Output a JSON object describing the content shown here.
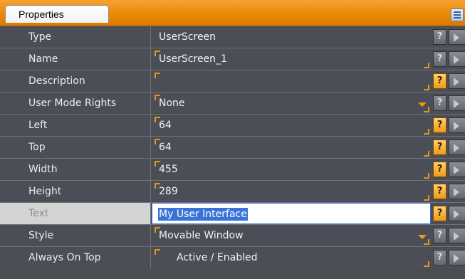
{
  "panel": {
    "tab_label": "Properties",
    "corner_icon": "list-view-icon"
  },
  "properties": [
    {
      "label": "Type",
      "value": "UserScreen",
      "kind": "readonly",
      "help_active": false
    },
    {
      "label": "Name",
      "value": "UserScreen_1",
      "kind": "text",
      "help_active": false
    },
    {
      "label": "Description",
      "value": "",
      "kind": "text",
      "help_active": true
    },
    {
      "label": "User Mode Rights",
      "value": "None",
      "kind": "dropdown",
      "help_active": false
    },
    {
      "label": "Left",
      "value": "64",
      "kind": "text",
      "help_active": true
    },
    {
      "label": "Top",
      "value": "64",
      "kind": "text",
      "help_active": true
    },
    {
      "label": "Width",
      "value": "455",
      "kind": "text",
      "help_active": true
    },
    {
      "label": "Height",
      "value": "289",
      "kind": "text",
      "help_active": true
    },
    {
      "label": "Text",
      "value": "My User Interface",
      "kind": "editing",
      "help_active": true
    },
    {
      "label": "Style",
      "value": "Movable Window",
      "kind": "dropdown",
      "help_active": false
    },
    {
      "label": "Always On Top",
      "value": "Active / Enabled",
      "kind": "checkbox",
      "help_active": false
    }
  ],
  "help_glyph": "?",
  "colors": {
    "accent": "#e98705",
    "background": "#4b4d55",
    "selection": "#3874d8"
  }
}
